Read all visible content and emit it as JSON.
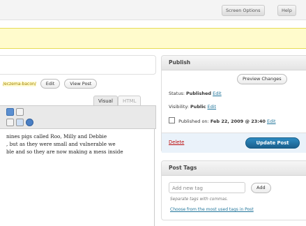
{
  "header": {
    "screen_options": "Screen Options",
    "help": "Help"
  },
  "post": {
    "permalink_slug": "/eczema-bacon/",
    "edit_button": "Edit",
    "view_post_button": "View Post",
    "tabs": {
      "visual": "Visual",
      "html": "HTML"
    },
    "content_lines": [
      "nines pigs called Roo, Milly and Debbie",
      ", but as they were small and vulnerable we",
      "ble and so they are now making a mess inside"
    ]
  },
  "publish": {
    "title": "Publish",
    "preview_button": "Preview Changes",
    "status_label": "Status:",
    "status_value": "Published",
    "visibility_label": "Visibility:",
    "visibility_value": "Public",
    "published_label": "Published on:",
    "published_value": "Feb 22, 2009 @ 23:40",
    "edit_link": "Edit",
    "delete_link": "Delete",
    "update_button": "Update Post"
  },
  "tags": {
    "title": "Post Tags",
    "input_placeholder": "Add new tag",
    "add_button": "Add",
    "hint": "Separate tags with commas.",
    "choose_link": "Choose from the most used tags in Post"
  },
  "colors": {
    "notice_bg": "#fffbcc",
    "link": "#21759b",
    "delete": "#bc0b0b",
    "primary_button": "#1a5f8c"
  }
}
